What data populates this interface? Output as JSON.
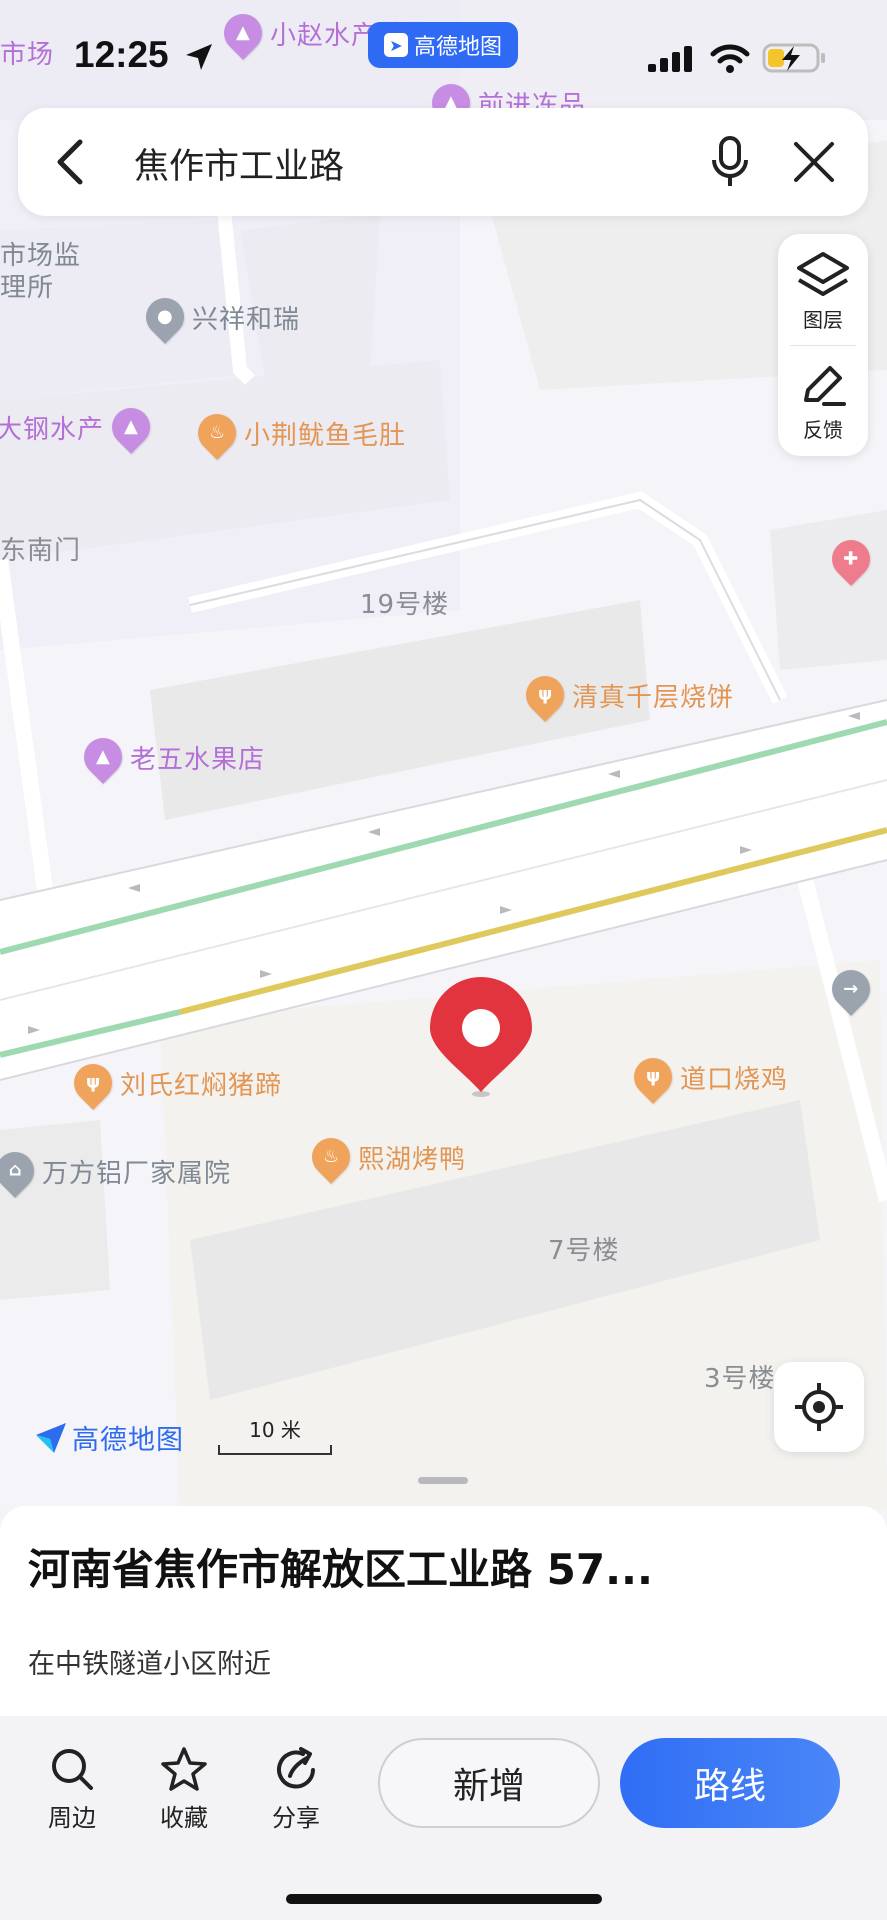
{
  "status_bar": {
    "time": "12:25",
    "app_badge": "高德地图"
  },
  "search": {
    "query": "焦作市工业路"
  },
  "side_panel": {
    "layers_label": "图层",
    "feedback_label": "反馈"
  },
  "map": {
    "pois": [
      {
        "name": "小赵水产蔬菜",
        "kind": "shop"
      },
      {
        "name": "前进冻品",
        "kind": "shop"
      },
      {
        "name": "兴祥和瑞",
        "kind": "grey"
      },
      {
        "name": "大钢水产",
        "kind": "shop"
      },
      {
        "name": "小荆鱿鱼毛肚",
        "kind": "food"
      },
      {
        "name": "清真千层烧饼",
        "kind": "food"
      },
      {
        "name": "老五水果店",
        "kind": "shop"
      },
      {
        "name": "刘氏红焖猪蹄",
        "kind": "food"
      },
      {
        "name": "道口烧鸡",
        "kind": "food"
      },
      {
        "name": "熙湖烤鸭",
        "kind": "food"
      },
      {
        "name": "万方铝厂家属院",
        "kind": "grey"
      }
    ],
    "labels": {
      "market_top": "市场",
      "market_office": "市场监\n理所",
      "southeast_gate": "东南门",
      "building_19": "19号楼",
      "building_7": "7号楼",
      "building_3": "3号楼"
    },
    "logo": "高德地图",
    "scale": "10 米"
  },
  "sheet": {
    "address": "河南省焦作市解放区工业路 57...",
    "nearby": "在中铁隧道小区附近",
    "actions": {
      "nearby": "周边",
      "favorite": "收藏",
      "share": "分享"
    },
    "add_button": "新增",
    "route_button": "路线"
  },
  "colors": {
    "accent": "#2f6ef5",
    "marker": "#e2343f",
    "road_green": "#9fd9b1",
    "road_yellow": "#e0c95c"
  }
}
